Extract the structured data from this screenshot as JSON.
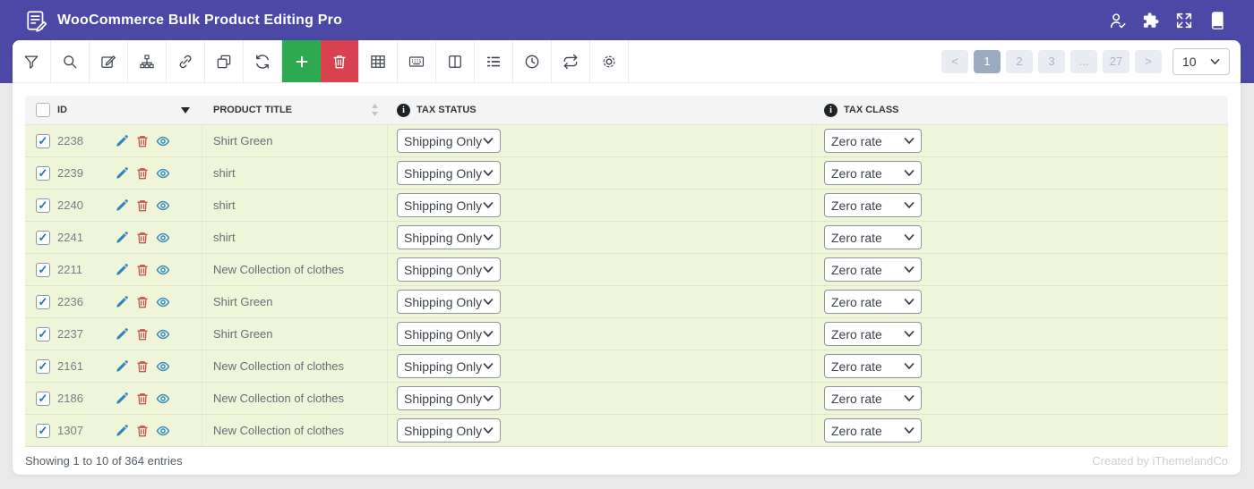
{
  "header": {
    "title": "WooCommerce Bulk Product Editing Pro",
    "icons": [
      "user-check",
      "puzzle",
      "fullscreen",
      "book"
    ]
  },
  "toolbar": {
    "tools": [
      "filter",
      "search",
      "bulk-edit",
      "hierarchy",
      "link",
      "duplicate",
      "refresh",
      "add-product",
      "delete",
      "table-view",
      "meta-fields",
      "columns",
      "list-view",
      "history",
      "sync",
      "settings"
    ],
    "pagination": {
      "prev": "<",
      "pages": [
        "1",
        "2",
        "3",
        "...",
        "27"
      ],
      "active_page": "1",
      "next": ">",
      "page_size": "10"
    }
  },
  "table": {
    "columns": {
      "id": "ID",
      "title": "PRODUCT TITLE",
      "tax_status": "TAX STATUS",
      "tax_class": "TAX CLASS"
    },
    "rows": [
      {
        "id": "2238",
        "title": "Shirt Green",
        "tax_status": "Shipping Only",
        "tax_class": "Zero rate"
      },
      {
        "id": "2239",
        "title": "shirt",
        "tax_status": "Shipping Only",
        "tax_class": "Zero rate"
      },
      {
        "id": "2240",
        "title": "shirt",
        "tax_status": "Shipping Only",
        "tax_class": "Zero rate"
      },
      {
        "id": "2241",
        "title": "shirt",
        "tax_status": "Shipping Only",
        "tax_class": "Zero rate"
      },
      {
        "id": "2211",
        "title": "New Collection of clothes",
        "tax_status": "Shipping Only",
        "tax_class": "Zero rate"
      },
      {
        "id": "2236",
        "title": "Shirt Green",
        "tax_status": "Shipping Only",
        "tax_class": "Zero rate"
      },
      {
        "id": "2237",
        "title": "Shirt Green",
        "tax_status": "Shipping Only",
        "tax_class": "Zero rate"
      },
      {
        "id": "2161",
        "title": "New Collection of clothes",
        "tax_status": "Shipping Only",
        "tax_class": "Zero rate"
      },
      {
        "id": "2186",
        "title": "New Collection of clothes",
        "tax_status": "Shipping Only",
        "tax_class": "Zero rate"
      },
      {
        "id": "1307",
        "title": "New Collection of clothes",
        "tax_status": "Shipping Only",
        "tax_class": "Zero rate"
      }
    ]
  },
  "footer": {
    "showing": "Showing 1 to 10 of 364 entries",
    "credit": "Created by iThemelandCo"
  },
  "colors": {
    "header_purple": "#4b48a6",
    "add_green": "#2daa4f",
    "delete_red": "#d8414f",
    "row_green": "#eef5d9",
    "active_page_bg": "#9dabc0"
  }
}
